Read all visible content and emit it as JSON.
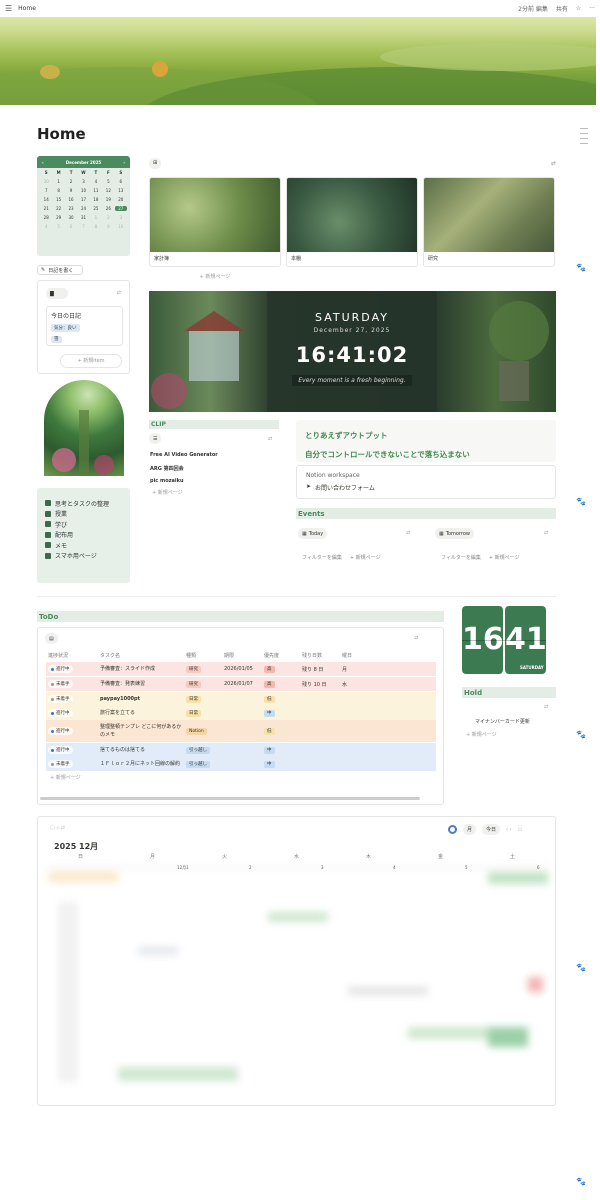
{
  "topbar": {
    "title": "Home",
    "edited": "2分前 編集",
    "share": "共有"
  },
  "page": {
    "title": "Home"
  },
  "calendar": {
    "month": "December 2025",
    "weekdays": [
      "S",
      "M",
      "T",
      "W",
      "T",
      "F",
      "S"
    ],
    "days": [
      [
        "30",
        "1",
        "2",
        "3",
        "4",
        "5",
        "6"
      ],
      [
        "7",
        "8",
        "9",
        "10",
        "11",
        "12",
        "13"
      ],
      [
        "14",
        "15",
        "16",
        "17",
        "18",
        "19",
        "20"
      ],
      [
        "21",
        "22",
        "23",
        "24",
        "25",
        "26",
        "27"
      ],
      [
        "28",
        "29",
        "30",
        "31",
        "1",
        "2",
        "3"
      ],
      [
        "4",
        "5",
        "6",
        "7",
        "8",
        "9",
        "10"
      ]
    ],
    "today": "27"
  },
  "diary": {
    "button": "日記を書く",
    "item_title": "今日の日記",
    "tags": [
      "気分：良い",
      "雪"
    ],
    "new_item": "+ 新規item"
  },
  "sidebar_menu": [
    "思考とタスクの整理",
    "授業",
    "学び",
    "配布用",
    "メモ",
    "スマホ用ページ"
  ],
  "gallery": {
    "cards": [
      "家計簿",
      "本棚",
      "研究"
    ],
    "new_page": "+ 新規ページ"
  },
  "banner": {
    "day": "SATURDAY",
    "date": "December 27, 2025",
    "time": "16:41:02",
    "quote": "Every moment is a fresh beginning."
  },
  "clip": {
    "header": "CLIP",
    "items": [
      "Free AI Video Generator",
      "ARG 第四回会",
      "pic mozaiku"
    ],
    "new_page": "+ 新規ページ"
  },
  "quote_box": {
    "line1": "とりあえずアウトプット",
    "line2": "自分でコントロールできないことで落ち込まない"
  },
  "notion_box": {
    "title": "Notion workspace",
    "link": "お問い合わせフォーム"
  },
  "events": {
    "header": "Events",
    "today": "Today",
    "tomorrow": "Tomorrow",
    "filter": "フィルターを編集",
    "new_page": "+ 新規ページ"
  },
  "todo": {
    "header": "ToDo",
    "columns": [
      "進捗状況",
      "タスク名",
      "種類",
      "期限",
      "優先度",
      "残り日数",
      "曜日"
    ],
    "rows": [
      {
        "status": "進行中",
        "name": "予備審査：スライド作成",
        "kind": "研究",
        "due": "2026/01/05",
        "prio": "高",
        "left": "残り 8 日",
        "dow": "月"
      },
      {
        "status": "未着手",
        "name": "予備審査：発表練習",
        "kind": "研究",
        "due": "2026/01/07",
        "prio": "高",
        "left": "残り 10 日",
        "dow": "水"
      },
      {
        "status": "未着手",
        "name": "paypay1000pt",
        "kind": "日常",
        "due": "",
        "prio": "低",
        "left": "",
        "dow": ""
      },
      {
        "status": "進行中",
        "name": "旅行案を立てる",
        "kind": "日常",
        "due": "",
        "prio": "中",
        "left": "",
        "dow": ""
      },
      {
        "status": "進行中",
        "name": "整理整頓テンプレ どこに何があるかのメモ",
        "kind": "Notion",
        "due": "",
        "prio": "低",
        "left": "",
        "dow": ""
      },
      {
        "status": "進行中",
        "name": "捨てるものは捨てる",
        "kind": "引っ越し",
        "due": "",
        "prio": "中",
        "left": "",
        "dow": ""
      },
      {
        "status": "未着手",
        "name": "１Ｆｌｏｒ２月にネット回線の解約",
        "kind": "引っ越し",
        "due": "",
        "prio": "中",
        "left": "",
        "dow": ""
      }
    ],
    "new_page": "+ 新規ページ"
  },
  "flip_clock": {
    "hour": "16",
    "minute": "41",
    "day": "SATURDAY"
  },
  "hold": {
    "header": "Hold",
    "item": "マイナンバーカード更新",
    "new_page": "+ 新規ページ"
  },
  "big_calendar": {
    "title": "2025 12月",
    "view": "月",
    "today_btn": "今日",
    "weekdays": [
      "日",
      "月",
      "火",
      "水",
      "木",
      "金",
      "土"
    ],
    "first_row": [
      "",
      "12月1",
      "2",
      "3",
      "4",
      "5",
      "6"
    ]
  },
  "colors": {
    "accent": "#4c8a5f",
    "light": "#e3ede5",
    "red_row": "#fbe4e1",
    "yellow_row": "#fbf3db",
    "blue_row": "#e1ecf8"
  }
}
